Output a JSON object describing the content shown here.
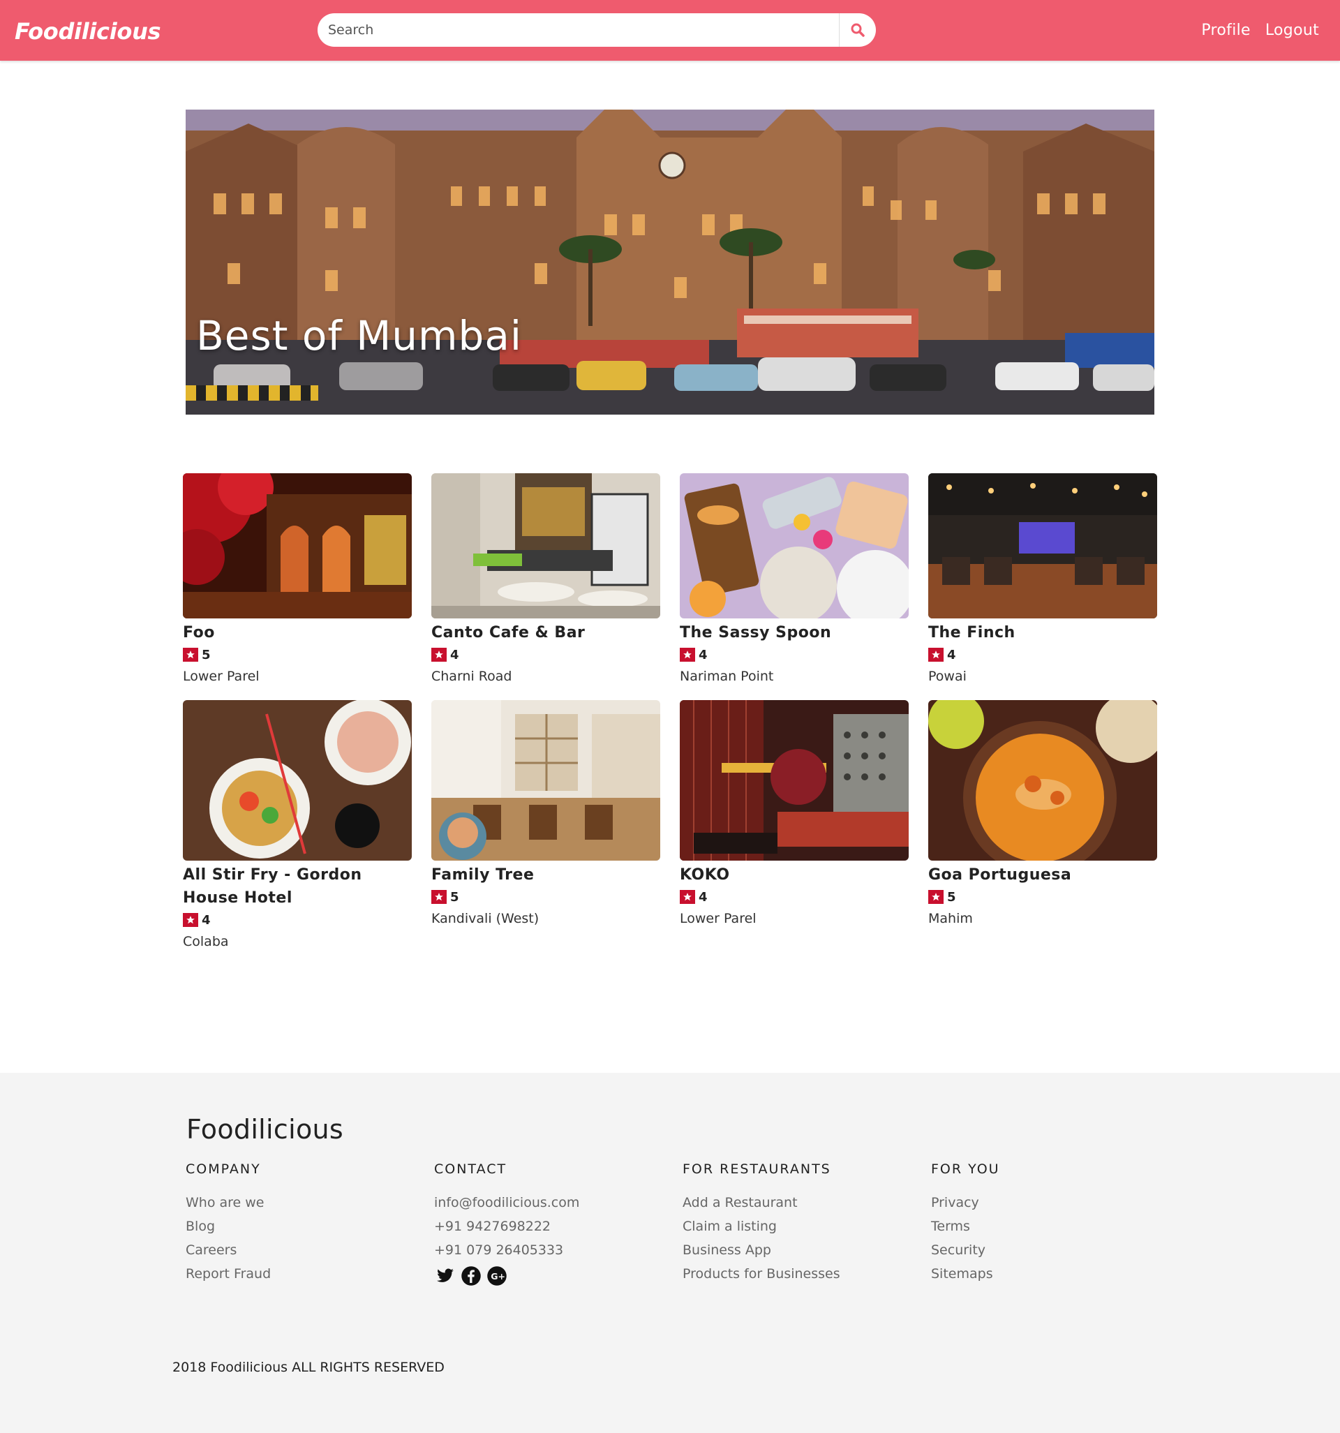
{
  "navbar": {
    "brand": "Foodilicious",
    "search_placeholder": "Search",
    "links": [
      "Profile",
      "Logout"
    ]
  },
  "hero": {
    "title": "Best of Mumbai"
  },
  "restaurants": [
    {
      "name": "Foo",
      "rating": "5",
      "location": "Lower Parel"
    },
    {
      "name": "Canto Cafe & Bar",
      "rating": "4",
      "location": "Charni Road"
    },
    {
      "name": "The Sassy Spoon",
      "rating": "4",
      "location": "Nariman Point"
    },
    {
      "name": "The Finch",
      "rating": "4",
      "location": "Powai"
    },
    {
      "name": "All Stir Fry - Gordon House Hotel",
      "rating": "4",
      "location": "Colaba"
    },
    {
      "name": "Family Tree",
      "rating": "5",
      "location": "Kandivali (West)"
    },
    {
      "name": "KOKO",
      "rating": "4",
      "location": "Lower Parel"
    },
    {
      "name": "Goa Portuguesa",
      "rating": "5",
      "location": "Mahim"
    }
  ],
  "footer": {
    "brand": "Foodilicious",
    "columns": [
      {
        "heading": "COMPANY",
        "links": [
          "Who are we",
          "Blog",
          "Careers",
          "Report Fraud"
        ]
      },
      {
        "heading": "CONTACT",
        "links": [
          "info@foodilicious.com",
          "+91 9427698222",
          "+91 079 26405333"
        ]
      },
      {
        "heading": "FOR RESTAURANTS",
        "links": [
          "Add a Restaurant",
          "Claim a listing",
          "Business App",
          "Products for Businesses"
        ]
      },
      {
        "heading": "FOR YOU",
        "links": [
          "Privacy",
          "Terms",
          "Security",
          "Sitemaps"
        ]
      }
    ],
    "social_icons": [
      "twitter-icon",
      "facebook-icon",
      "google-plus-icon"
    ],
    "copyright": "2018 Foodilicious ALL RIGHTS RESERVED"
  },
  "colors": {
    "brand": "#ef5b6e",
    "star": "#c8102e",
    "footer_bg": "#f4f4f4"
  }
}
